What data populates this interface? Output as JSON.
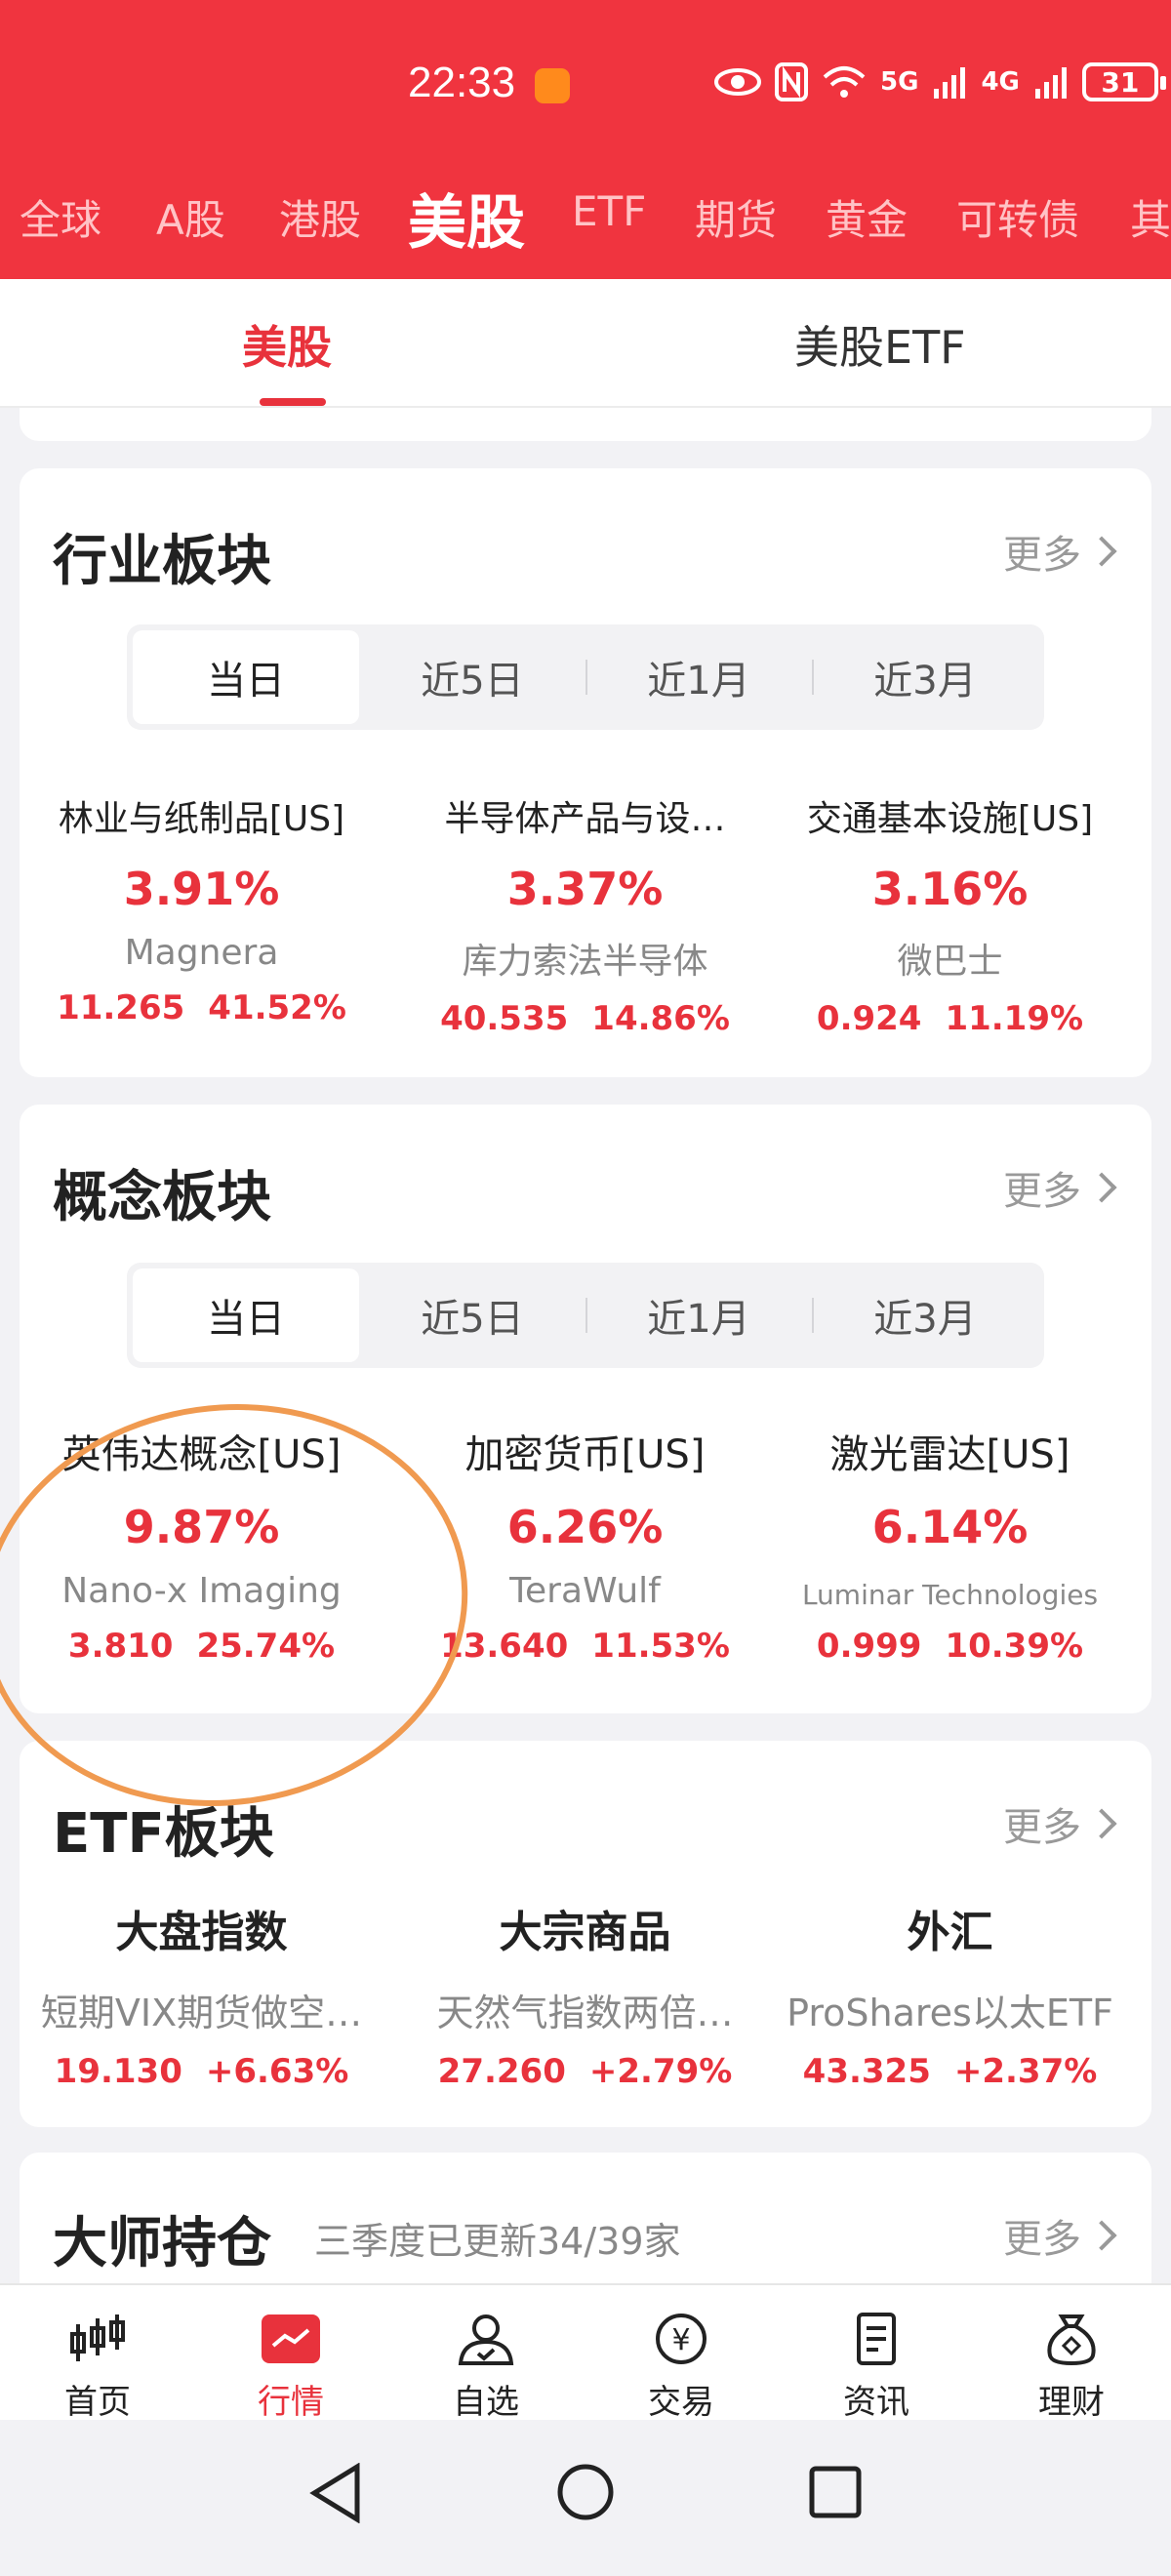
{
  "status": {
    "time": "22:33",
    "battery": "31",
    "net1": "5G",
    "net2": "4G"
  },
  "market_tabs": [
    "全球",
    "A股",
    "港股",
    "美股",
    "ETF",
    "期货",
    "黄金",
    "可转债",
    "其"
  ],
  "sub_tabs": [
    "美股",
    "美股ETF"
  ],
  "industry": {
    "title": "行业板块",
    "more": "更多",
    "periods": [
      "当日",
      "近5日",
      "近1月",
      "近3月"
    ],
    "items": [
      {
        "name": "林业与纸制品[US]",
        "pct": "3.91%",
        "leader": "Magnera",
        "price": "11.265",
        "change": "41.52%"
      },
      {
        "name": "半导体产品与设…",
        "pct": "3.37%",
        "leader": "库力索法半导体",
        "price": "40.535",
        "change": "14.86%"
      },
      {
        "name": "交通基本设施[US]",
        "pct": "3.16%",
        "leader": "微巴士",
        "price": "0.924",
        "change": "11.19%"
      }
    ]
  },
  "concept": {
    "title": "概念板块",
    "more": "更多",
    "periods": [
      "当日",
      "近5日",
      "近1月",
      "近3月"
    ],
    "items": [
      {
        "name": "英伟达概念[US]",
        "pct": "9.87%",
        "leader": "Nano-x Imaging",
        "price": "3.810",
        "change": "25.74%"
      },
      {
        "name": "加密货币[US]",
        "pct": "6.26%",
        "leader": "TeraWulf",
        "price": "13.640",
        "change": "11.53%"
      },
      {
        "name": "激光雷达[US]",
        "pct": "6.14%",
        "leader": "Luminar Technologies",
        "price": "0.999",
        "change": "10.39%"
      }
    ]
  },
  "etf": {
    "title": "ETF板块",
    "more": "更多",
    "items": [
      {
        "name": "大盘指数",
        "sub": "短期VIX期货做空…",
        "price": "19.130",
        "change": "+6.63%"
      },
      {
        "name": "大宗商品",
        "sub": "天然气指数两倍…",
        "price": "27.260",
        "change": "+2.79%"
      },
      {
        "name": "外汇",
        "sub": "ProShares以太ETF",
        "price": "43.325",
        "change": "+2.37%"
      }
    ]
  },
  "master": {
    "title": "大师持仓",
    "subtitle": "三季度已更新34/39家",
    "more": "更多"
  },
  "nav": [
    {
      "label": "首页",
      "icon": "candlestick-icon"
    },
    {
      "label": "行情",
      "icon": "market-chart-icon"
    },
    {
      "label": "自选",
      "icon": "person-check-icon"
    },
    {
      "label": "交易",
      "icon": "yen-coin-icon"
    },
    {
      "label": "资讯",
      "icon": "document-icon"
    },
    {
      "label": "理财",
      "icon": "money-bag-icon"
    }
  ]
}
